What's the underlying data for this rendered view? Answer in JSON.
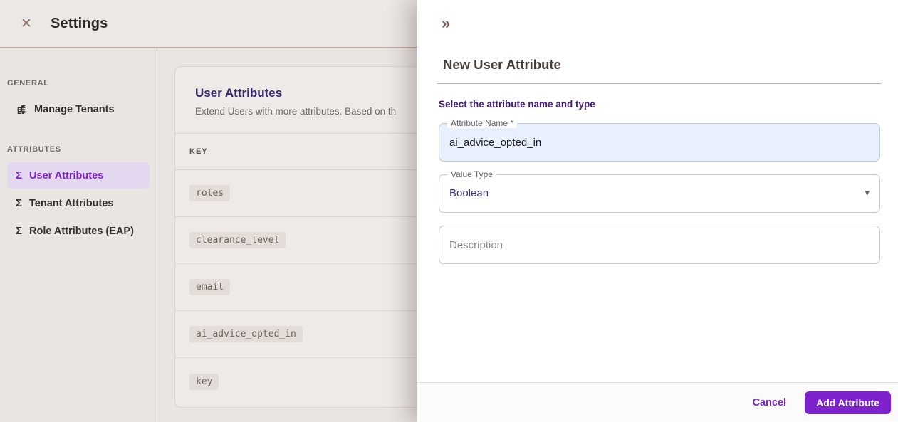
{
  "icons": {
    "close": "✕",
    "collapse": "»",
    "sigma": "Σ",
    "caret": "▾"
  },
  "page": {
    "title": "Settings"
  },
  "sidebar": {
    "sections": [
      {
        "label": "GENERAL",
        "items": [
          {
            "label": "Manage Tenants",
            "icon": "building-icon",
            "selected": false
          }
        ]
      },
      {
        "label": "ATTRIBUTES",
        "items": [
          {
            "label": "User Attributes",
            "icon": "sigma-icon",
            "selected": true
          },
          {
            "label": "Tenant Attributes",
            "icon": "sigma-icon",
            "selected": false
          },
          {
            "label": "Role Attributes (EAP)",
            "icon": "sigma-icon",
            "selected": false
          }
        ]
      }
    ]
  },
  "main": {
    "card": {
      "title": "User Attributes",
      "subtitle": "Extend Users with more attributes. Based on th",
      "table": {
        "columns": [
          "KEY"
        ],
        "rows": [
          "roles",
          "clearance_level",
          "email",
          "ai_advice_opted_in",
          "key"
        ]
      }
    }
  },
  "drawer": {
    "title": "New User Attribute",
    "section_label": "Select the attribute name and type",
    "fields": {
      "attribute_name": {
        "label": "Attribute Name *",
        "value": "ai_advice_opted_in"
      },
      "value_type": {
        "label": "Value Type",
        "value": "Boolean"
      },
      "description": {
        "placeholder": "Description"
      }
    },
    "footer": {
      "cancel_label": "Cancel",
      "submit_label": "Add Attribute"
    }
  },
  "colors": {
    "accent": "#7e22ce",
    "selected_nav_bg": "#e4d8f1",
    "autofill_field_bg": "#e8f0fe",
    "card_title": "#37276d",
    "drawer_bg": "#ffffff"
  }
}
